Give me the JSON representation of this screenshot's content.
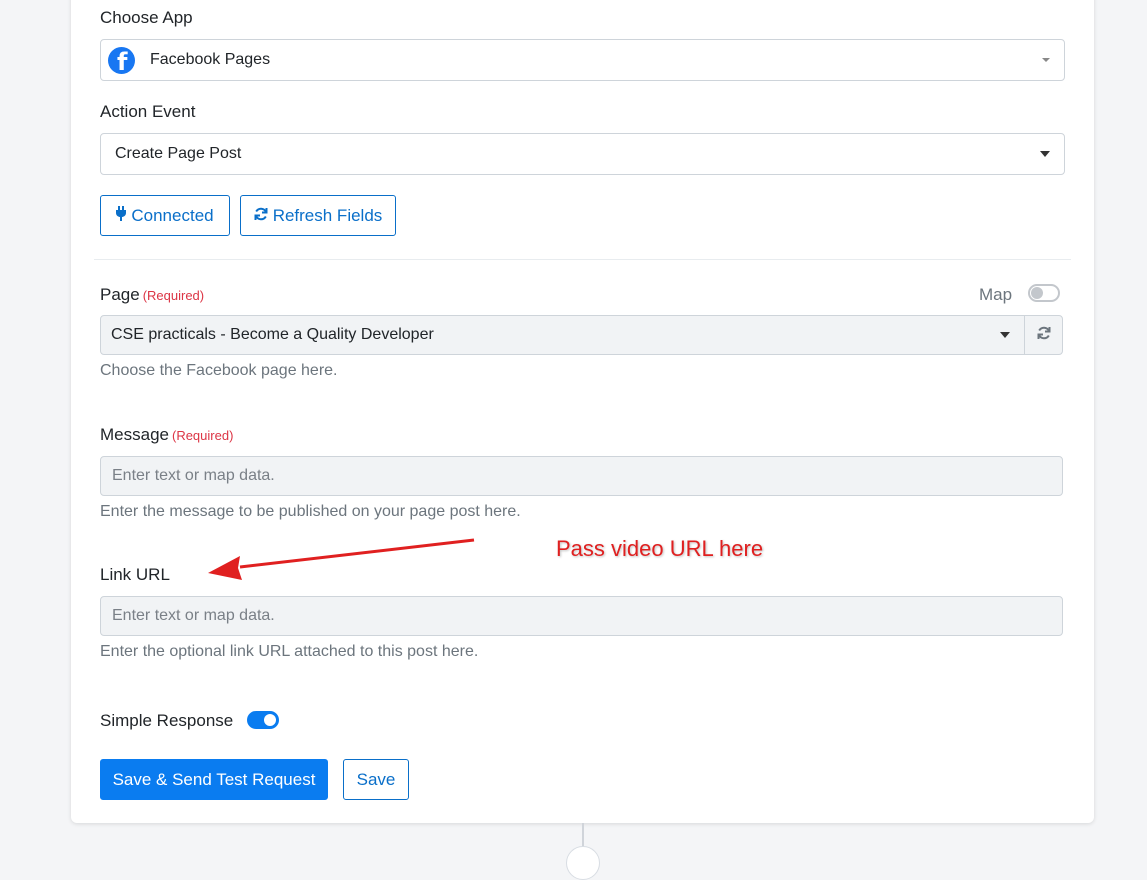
{
  "choose_app": {
    "label": "Choose App",
    "selected": "Facebook Pages"
  },
  "action_event": {
    "label": "Action Event",
    "selected": "Create Page Post"
  },
  "buttons": {
    "connected": "Connected",
    "refresh_fields": "Refresh Fields",
    "save_send": "Save & Send Test Request",
    "save": "Save"
  },
  "page_field": {
    "label": "Page",
    "required": "(Required)",
    "map_label": "Map",
    "map_enabled": false,
    "selected": "CSE practicals - Become a Quality Developer",
    "help": "Choose the Facebook page here."
  },
  "message_field": {
    "label": "Message",
    "required": "(Required)",
    "placeholder": "Enter text or map data.",
    "help": "Enter the message to be published on your page post here."
  },
  "link_field": {
    "label": "Link URL",
    "placeholder": "Enter text or map data.",
    "help": "Enter the optional link URL attached to this post here."
  },
  "simple_response": {
    "label": "Simple Response",
    "enabled": true
  },
  "annotation": {
    "text": "Pass video URL here",
    "color": "#e02020"
  },
  "colors": {
    "primary": "#0a7cf0",
    "outline": "#0a6fc9",
    "required": "#dc3545",
    "facebook": "#1877f2"
  }
}
